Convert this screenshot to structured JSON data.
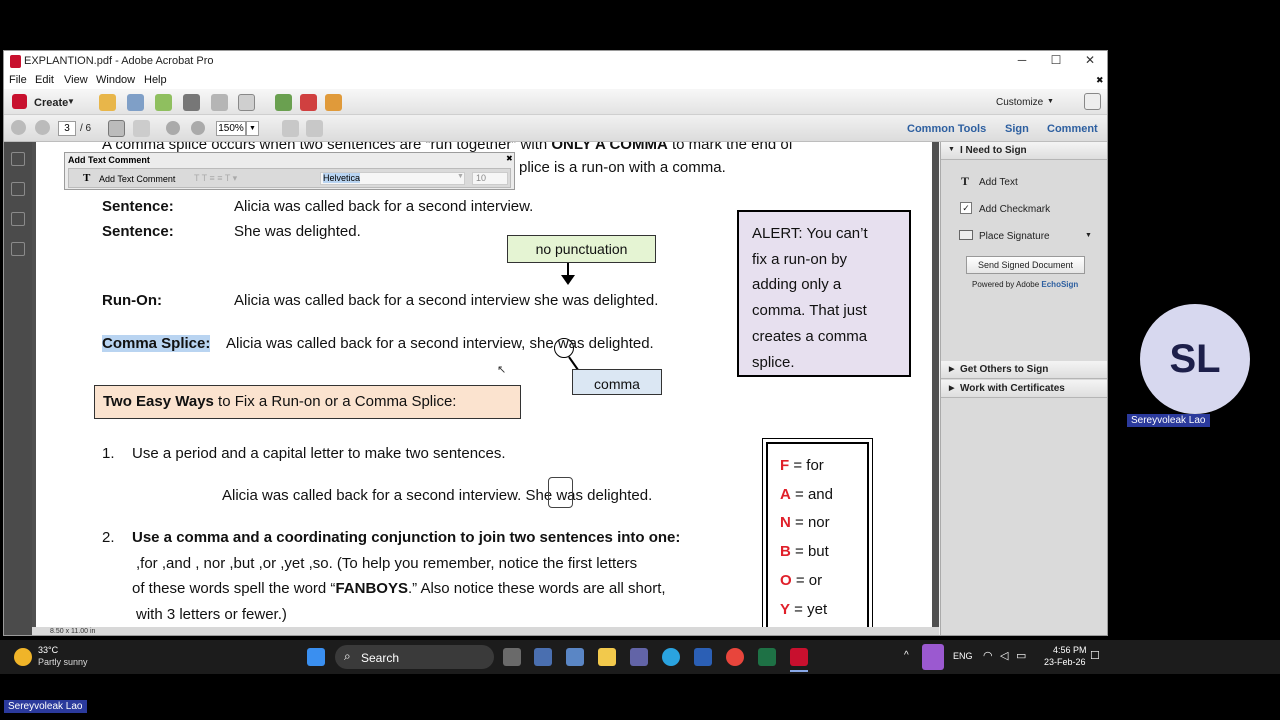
{
  "window": {
    "title": "EXPLANTION.pdf - Adobe Acrobat Pro",
    "min": "─",
    "max": "☐",
    "close": "✕",
    "close_doc": "✖"
  },
  "menu": [
    "File",
    "Edit",
    "View",
    "Window",
    "Help"
  ],
  "toolbar": {
    "create": "Create",
    "customize": "Customize",
    "page_current": "3",
    "page_total": "/ 6",
    "zoom": "150%",
    "tabs": [
      "Common Tools",
      "Sign",
      "Comment"
    ]
  },
  "comment_popup": {
    "title": "Add Text Comment",
    "action": "Add Text Comment",
    "font": "Helvetica",
    "size": "10",
    "close": "✖"
  },
  "document": {
    "line1": "A comma splice occurs when two sentences are “run together” with ONLY A COMMA to mark the end of",
    "line1_bold": "ONLY A COMMA",
    "line2": "plice is a run-on with a comma.",
    "sentence_label": "Sentence:",
    "sentence1": "Alicia was called back for a second interview.",
    "sentence2": "She was delighted.",
    "no_punct": "no punctuation",
    "runon_label": "Run-On:",
    "runon_text": "Alicia was called back for a second interview she was delighted.",
    "splice_label": "Comma Splice:",
    "splice_text": "Alicia was called back for a second interview, she was delighted.",
    "comma_box": "comma",
    "alert": [
      "ALERT:  You can’t",
      "fix a run-on by",
      "adding only a",
      "comma. That just",
      "creates a comma",
      "splice."
    ],
    "easy_ways_bold": "Two Easy Ways",
    "easy_ways_rest": " to Fix a Run-on or a Comma Splice:",
    "item1_num": "1.",
    "item1": "Use a period and a capital letter to make two sentences.",
    "item1_example": "Alicia was called back for a second interview. She was delighted.",
    "item2_num": "2.",
    "item2": "Use a comma and a coordinating conjunction to join two sentences into one:",
    "item2_line2": ",for  ,and  , nor  ,but  ,or  ,yet  ,so. (To help you remember, notice the first letters",
    "item2_line3a": "of these words spell the word “",
    "item2_line3b": "FANBOYS",
    "item2_line3c": ".” Also notice these words are all short,",
    "item2_line4": "with 3 letters or fewer.)",
    "fanboys": [
      {
        "letter": "F",
        "word": "for"
      },
      {
        "letter": "A",
        "word": "and"
      },
      {
        "letter": "N",
        "word": "nor"
      },
      {
        "letter": "B",
        "word": "but"
      },
      {
        "letter": "O",
        "word": "or"
      },
      {
        "letter": "Y",
        "word": "yet"
      }
    ],
    "page_size": "8.50 x 11.00 in"
  },
  "right_panel": {
    "need_to_sign": "I Need to Sign",
    "add_text": "Add Text",
    "add_checkmark": "Add Checkmark",
    "place_signature": "Place Signature",
    "send_signed": "Send Signed Document",
    "powered_by": "Powered by Adobe ",
    "echosign": "EchoSign",
    "get_others": "Get Others to Sign",
    "certificates": "Work with Certificates"
  },
  "taskbar": {
    "temp": "33°C",
    "weather": "Partly sunny",
    "search": "Search",
    "lang": "ENG",
    "time": "4:56 PM",
    "date": "23-Feb-26"
  },
  "participant": {
    "initials": "SL",
    "name": "Sereyvoleak Lao",
    "name_bottom": "Sereyvoleak Lao"
  },
  "colors": {
    "fanboys_red": "#e0202a",
    "easy_ways_bg": "#fbe3cf",
    "alert_bg": "#e7e0ef",
    "no_punct_bg": "#e5f4d3",
    "comma_bg": "#dbe7f3",
    "highlight": "#b9d4f1"
  }
}
